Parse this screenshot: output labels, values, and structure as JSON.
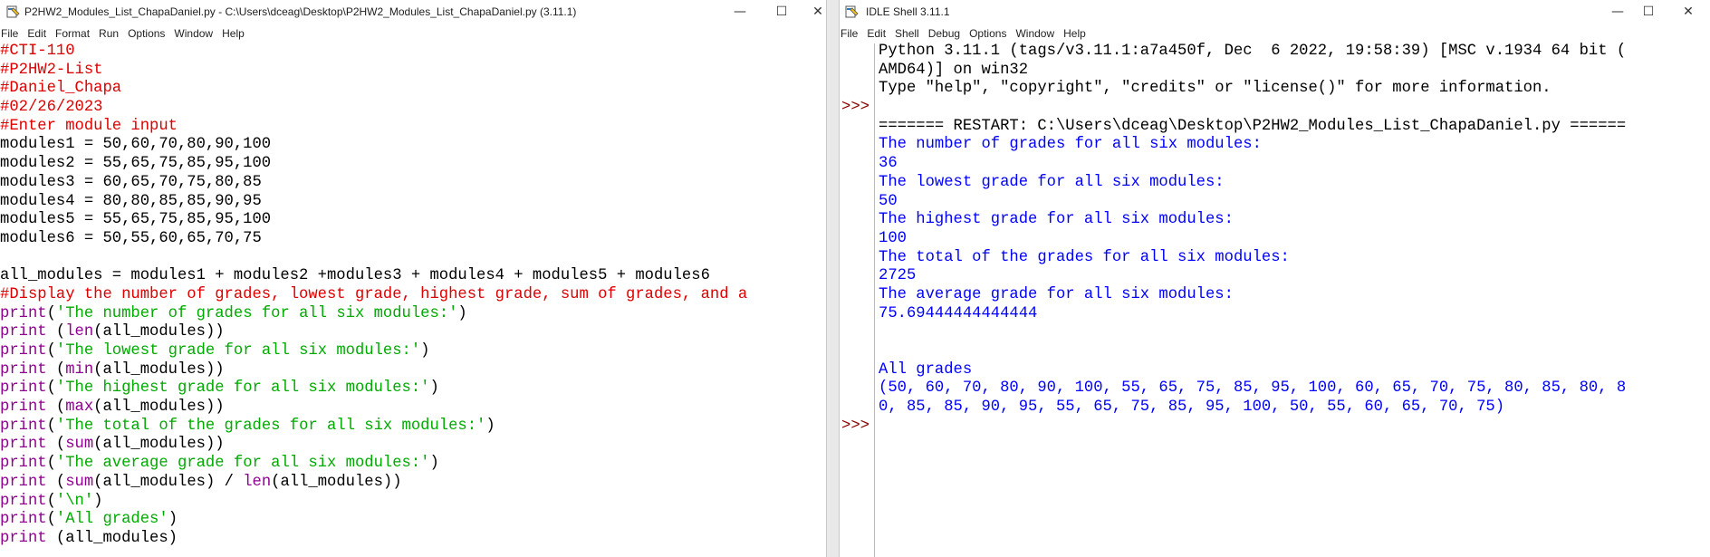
{
  "editor": {
    "title": "P2HW2_Modules_List_ChapaDaniel.py - C:\\Users\\dceag\\Desktop\\P2HW2_Modules_List_ChapaDaniel.py (3.11.1)",
    "menu": [
      "File",
      "Edit",
      "Format",
      "Run",
      "Options",
      "Window",
      "Help"
    ],
    "controls": {
      "minimize": "—",
      "maximize": "☐",
      "close": "✕"
    },
    "lines": [
      [
        {
          "t": "#CTI-110",
          "c": "com"
        }
      ],
      [
        {
          "t": "#P2HW2-List",
          "c": "com"
        }
      ],
      [
        {
          "t": "#Daniel_Chapa",
          "c": "com"
        }
      ],
      [
        {
          "t": "#02/26/2023",
          "c": "com"
        }
      ],
      [
        {
          "t": "#Enter module input",
          "c": "com"
        }
      ],
      [
        {
          "t": "modules1 = 50,60,70,80,90,100",
          "c": "def"
        }
      ],
      [
        {
          "t": "modules2 = 55,65,75,85,95,100",
          "c": "def"
        }
      ],
      [
        {
          "t": "modules3 = 60,65,70,75,80,85",
          "c": "def"
        }
      ],
      [
        {
          "t": "modules4 = 80,80,85,85,90,95",
          "c": "def"
        }
      ],
      [
        {
          "t": "modules5 = 55,65,75,85,95,100",
          "c": "def"
        }
      ],
      [
        {
          "t": "modules6 = 50,55,60,65,70,75",
          "c": "def"
        }
      ],
      [
        {
          "t": "",
          "c": "def"
        }
      ],
      [
        {
          "t": "all_modules = modules1 + modules2 +modules3 + modules4 + modules5 + modules6",
          "c": "def"
        }
      ],
      [
        {
          "t": "#Display the number of grades, lowest grade, highest grade, sum of grades, and a",
          "c": "com"
        }
      ],
      [
        {
          "t": "print",
          "c": "kw"
        },
        {
          "t": "(",
          "c": "def"
        },
        {
          "t": "'The number of grades for all six modules:'",
          "c": "str"
        },
        {
          "t": ")",
          "c": "def"
        }
      ],
      [
        {
          "t": "print",
          "c": "kw"
        },
        {
          "t": " (",
          "c": "def"
        },
        {
          "t": "len",
          "c": "kw"
        },
        {
          "t": "(all_modules))",
          "c": "def"
        }
      ],
      [
        {
          "t": "print",
          "c": "kw"
        },
        {
          "t": "(",
          "c": "def"
        },
        {
          "t": "'The lowest grade for all six modules:'",
          "c": "str"
        },
        {
          "t": ")",
          "c": "def"
        }
      ],
      [
        {
          "t": "print",
          "c": "kw"
        },
        {
          "t": " (",
          "c": "def"
        },
        {
          "t": "min",
          "c": "kw"
        },
        {
          "t": "(all_modules))",
          "c": "def"
        }
      ],
      [
        {
          "t": "print",
          "c": "kw"
        },
        {
          "t": "(",
          "c": "def"
        },
        {
          "t": "'The highest grade for all six modules:'",
          "c": "str"
        },
        {
          "t": ")",
          "c": "def"
        }
      ],
      [
        {
          "t": "print",
          "c": "kw"
        },
        {
          "t": " (",
          "c": "def"
        },
        {
          "t": "max",
          "c": "kw"
        },
        {
          "t": "(all_modules))",
          "c": "def"
        }
      ],
      [
        {
          "t": "print",
          "c": "kw"
        },
        {
          "t": "(",
          "c": "def"
        },
        {
          "t": "'The total of the grades for all six modules:'",
          "c": "str"
        },
        {
          "t": ")",
          "c": "def"
        }
      ],
      [
        {
          "t": "print",
          "c": "kw"
        },
        {
          "t": " (",
          "c": "def"
        },
        {
          "t": "sum",
          "c": "kw"
        },
        {
          "t": "(all_modules))",
          "c": "def"
        }
      ],
      [
        {
          "t": "print",
          "c": "kw"
        },
        {
          "t": "(",
          "c": "def"
        },
        {
          "t": "'The average grade for all six modules:'",
          "c": "str"
        },
        {
          "t": ")",
          "c": "def"
        }
      ],
      [
        {
          "t": "print",
          "c": "kw"
        },
        {
          "t": " (",
          "c": "def"
        },
        {
          "t": "sum",
          "c": "kw"
        },
        {
          "t": "(all_modules) / ",
          "c": "def"
        },
        {
          "t": "len",
          "c": "kw"
        },
        {
          "t": "(all_modules))",
          "c": "def"
        }
      ],
      [
        {
          "t": "print",
          "c": "kw"
        },
        {
          "t": "(",
          "c": "def"
        },
        {
          "t": "'\\n'",
          "c": "str"
        },
        {
          "t": ")",
          "c": "def"
        }
      ],
      [
        {
          "t": "print",
          "c": "kw"
        },
        {
          "t": "(",
          "c": "def"
        },
        {
          "t": "'All grades'",
          "c": "str"
        },
        {
          "t": ")",
          "c": "def"
        }
      ],
      [
        {
          "t": "print",
          "c": "kw"
        },
        {
          "t": " (all_modules)",
          "c": "def"
        }
      ]
    ]
  },
  "shell": {
    "title": "IDLE Shell 3.11.1",
    "menu": [
      "File",
      "Edit",
      "Shell",
      "Debug",
      "Options",
      "Window",
      "Help"
    ],
    "controls": {
      "minimize": "—",
      "maximize": "☐",
      "close": "✕"
    },
    "prompt": ">>>",
    "prompt_rows": [
      3,
      20
    ],
    "lines": [
      [
        {
          "t": "Python 3.11.1 (tags/v3.11.1:a7a450f, Dec  6 2022, 19:58:39) [MSC v.1934 64 bit (",
          "c": "def"
        }
      ],
      [
        {
          "t": "AMD64)] on win32",
          "c": "def"
        }
      ],
      [
        {
          "t": "Type \"help\", \"copyright\", \"credits\" or \"license()\" for more information.",
          "c": "def"
        }
      ],
      [
        {
          "t": "",
          "c": "def"
        }
      ],
      [
        {
          "t": "======= RESTART: C:\\Users\\dceag\\Desktop\\P2HW2_Modules_List_ChapaDaniel.py ======",
          "c": "def"
        }
      ],
      [
        {
          "t": "The number of grades for all six modules:",
          "c": "out"
        }
      ],
      [
        {
          "t": "36",
          "c": "out"
        }
      ],
      [
        {
          "t": "The lowest grade for all six modules:",
          "c": "out"
        }
      ],
      [
        {
          "t": "50",
          "c": "out"
        }
      ],
      [
        {
          "t": "The highest grade for all six modules:",
          "c": "out"
        }
      ],
      [
        {
          "t": "100",
          "c": "out"
        }
      ],
      [
        {
          "t": "The total of the grades for all six modules:",
          "c": "out"
        }
      ],
      [
        {
          "t": "2725",
          "c": "out"
        }
      ],
      [
        {
          "t": "The average grade for all six modules:",
          "c": "out"
        }
      ],
      [
        {
          "t": "75.69444444444444",
          "c": "out"
        }
      ],
      [
        {
          "t": "",
          "c": "out"
        }
      ],
      [
        {
          "t": "",
          "c": "out"
        }
      ],
      [
        {
          "t": "All grades",
          "c": "out"
        }
      ],
      [
        {
          "t": "(50, 60, 70, 80, 90, 100, 55, 65, 75, 85, 95, 100, 60, 65, 70, 75, 80, 85, 80, 8",
          "c": "out"
        }
      ],
      [
        {
          "t": "0, 85, 85, 90, 95, 55, 65, 75, 85, 95, 100, 50, 55, 60, 65, 70, 75)",
          "c": "out"
        }
      ],
      [
        {
          "t": "",
          "c": "out"
        }
      ]
    ]
  },
  "colors": {
    "comment": "#dd0000",
    "keyword": "#900090",
    "string": "#00aa00",
    "output": "#0000ff",
    "prompt": "#8b0000"
  }
}
